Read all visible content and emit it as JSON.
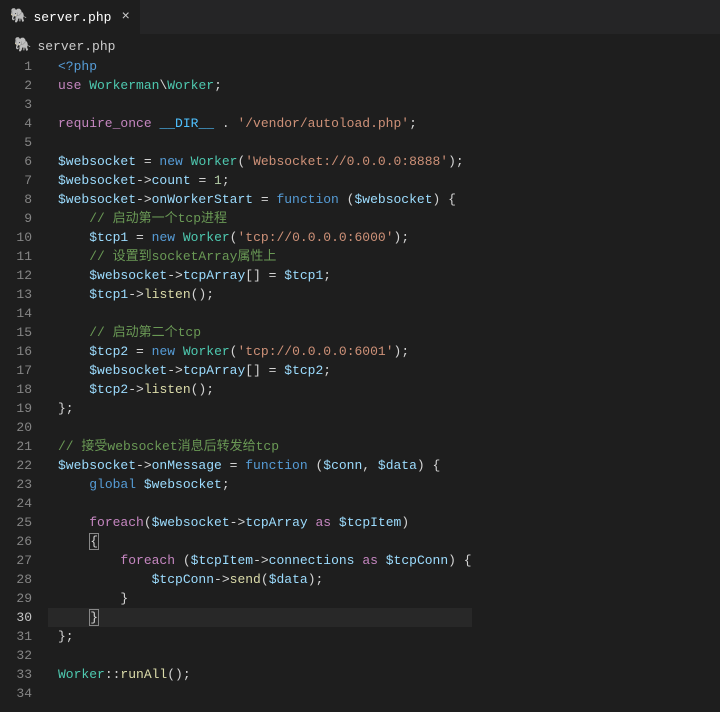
{
  "tab": {
    "filename": "server.php",
    "icon": "php-file-icon"
  },
  "breadcrumb": {
    "filename": "server.php"
  },
  "editor": {
    "activeLine": 30,
    "lines": [
      {
        "n": 1,
        "t": [
          {
            "c": "c-key",
            "s": "<?php"
          }
        ]
      },
      {
        "n": 2,
        "t": [
          {
            "c": "c-keyctl",
            "s": "use"
          },
          {
            "c": "c-pun",
            "s": " "
          },
          {
            "c": "c-type",
            "s": "Workerman"
          },
          {
            "c": "c-pun",
            "s": "\\"
          },
          {
            "c": "c-type",
            "s": "Worker"
          },
          {
            "c": "c-pun",
            "s": ";"
          }
        ]
      },
      {
        "n": 3,
        "t": []
      },
      {
        "n": 4,
        "t": [
          {
            "c": "c-keyctl",
            "s": "require_once"
          },
          {
            "c": "c-pun",
            "s": " "
          },
          {
            "c": "c-const",
            "s": "__DIR__"
          },
          {
            "c": "c-pun",
            "s": " . "
          },
          {
            "c": "c-str",
            "s": "'/vendor/autoload.php'"
          },
          {
            "c": "c-pun",
            "s": ";"
          }
        ]
      },
      {
        "n": 5,
        "t": []
      },
      {
        "n": 6,
        "t": [
          {
            "c": "c-var",
            "s": "$websocket"
          },
          {
            "c": "c-pun",
            "s": " = "
          },
          {
            "c": "c-key",
            "s": "new"
          },
          {
            "c": "c-pun",
            "s": " "
          },
          {
            "c": "c-type",
            "s": "Worker"
          },
          {
            "c": "c-pun",
            "s": "("
          },
          {
            "c": "c-str",
            "s": "'Websocket://0.0.0.0:8888'"
          },
          {
            "c": "c-pun",
            "s": ");"
          }
        ]
      },
      {
        "n": 7,
        "t": [
          {
            "c": "c-var",
            "s": "$websocket"
          },
          {
            "c": "c-pun",
            "s": "->"
          },
          {
            "c": "c-var",
            "s": "count"
          },
          {
            "c": "c-pun",
            "s": " = "
          },
          {
            "c": "c-num",
            "s": "1"
          },
          {
            "c": "c-pun",
            "s": ";"
          }
        ]
      },
      {
        "n": 8,
        "t": [
          {
            "c": "c-var",
            "s": "$websocket"
          },
          {
            "c": "c-pun",
            "s": "->"
          },
          {
            "c": "c-var",
            "s": "onWorkerStart"
          },
          {
            "c": "c-pun",
            "s": " = "
          },
          {
            "c": "c-key",
            "s": "function"
          },
          {
            "c": "c-pun",
            "s": " ("
          },
          {
            "c": "c-var",
            "s": "$websocket"
          },
          {
            "c": "c-pun",
            "s": ") {"
          }
        ]
      },
      {
        "n": 9,
        "t": [
          {
            "c": "c-pun",
            "s": "    "
          },
          {
            "c": "c-cmt",
            "s": "// 启动第一个tcp进程"
          }
        ]
      },
      {
        "n": 10,
        "t": [
          {
            "c": "c-pun",
            "s": "    "
          },
          {
            "c": "c-var",
            "s": "$tcp1"
          },
          {
            "c": "c-pun",
            "s": " = "
          },
          {
            "c": "c-key",
            "s": "new"
          },
          {
            "c": "c-pun",
            "s": " "
          },
          {
            "c": "c-type",
            "s": "Worker"
          },
          {
            "c": "c-pun",
            "s": "("
          },
          {
            "c": "c-str",
            "s": "'tcp://0.0.0.0:6000'"
          },
          {
            "c": "c-pun",
            "s": ");"
          }
        ]
      },
      {
        "n": 11,
        "t": [
          {
            "c": "c-pun",
            "s": "    "
          },
          {
            "c": "c-cmt",
            "s": "// 设置到socketArray属性上"
          }
        ]
      },
      {
        "n": 12,
        "t": [
          {
            "c": "c-pun",
            "s": "    "
          },
          {
            "c": "c-var",
            "s": "$websocket"
          },
          {
            "c": "c-pun",
            "s": "->"
          },
          {
            "c": "c-var",
            "s": "tcpArray"
          },
          {
            "c": "c-pun",
            "s": "[] = "
          },
          {
            "c": "c-var",
            "s": "$tcp1"
          },
          {
            "c": "c-pun",
            "s": ";"
          }
        ]
      },
      {
        "n": 13,
        "t": [
          {
            "c": "c-pun",
            "s": "    "
          },
          {
            "c": "c-var",
            "s": "$tcp1"
          },
          {
            "c": "c-pun",
            "s": "->"
          },
          {
            "c": "c-fn",
            "s": "listen"
          },
          {
            "c": "c-pun",
            "s": "();"
          }
        ]
      },
      {
        "n": 14,
        "t": []
      },
      {
        "n": 15,
        "t": [
          {
            "c": "c-pun",
            "s": "    "
          },
          {
            "c": "c-cmt",
            "s": "// 启动第二个tcp"
          }
        ]
      },
      {
        "n": 16,
        "t": [
          {
            "c": "c-pun",
            "s": "    "
          },
          {
            "c": "c-var",
            "s": "$tcp2"
          },
          {
            "c": "c-pun",
            "s": " = "
          },
          {
            "c": "c-key",
            "s": "new"
          },
          {
            "c": "c-pun",
            "s": " "
          },
          {
            "c": "c-type",
            "s": "Worker"
          },
          {
            "c": "c-pun",
            "s": "("
          },
          {
            "c": "c-str",
            "s": "'tcp://0.0.0.0:6001'"
          },
          {
            "c": "c-pun",
            "s": ");"
          }
        ]
      },
      {
        "n": 17,
        "t": [
          {
            "c": "c-pun",
            "s": "    "
          },
          {
            "c": "c-var",
            "s": "$websocket"
          },
          {
            "c": "c-pun",
            "s": "->"
          },
          {
            "c": "c-var",
            "s": "tcpArray"
          },
          {
            "c": "c-pun",
            "s": "[] = "
          },
          {
            "c": "c-var",
            "s": "$tcp2"
          },
          {
            "c": "c-pun",
            "s": ";"
          }
        ]
      },
      {
        "n": 18,
        "t": [
          {
            "c": "c-pun",
            "s": "    "
          },
          {
            "c": "c-var",
            "s": "$tcp2"
          },
          {
            "c": "c-pun",
            "s": "->"
          },
          {
            "c": "c-fn",
            "s": "listen"
          },
          {
            "c": "c-pun",
            "s": "();"
          }
        ]
      },
      {
        "n": 19,
        "t": [
          {
            "c": "c-pun",
            "s": "};"
          }
        ]
      },
      {
        "n": 20,
        "t": []
      },
      {
        "n": 21,
        "t": [
          {
            "c": "c-cmt",
            "s": "// 接受websocket消息后转发给tcp"
          }
        ]
      },
      {
        "n": 22,
        "t": [
          {
            "c": "c-var",
            "s": "$websocket"
          },
          {
            "c": "c-pun",
            "s": "->"
          },
          {
            "c": "c-var",
            "s": "onMessage"
          },
          {
            "c": "c-pun",
            "s": " = "
          },
          {
            "c": "c-key",
            "s": "function"
          },
          {
            "c": "c-pun",
            "s": " ("
          },
          {
            "c": "c-var",
            "s": "$conn"
          },
          {
            "c": "c-pun",
            "s": ", "
          },
          {
            "c": "c-var",
            "s": "$data"
          },
          {
            "c": "c-pun",
            "s": ") {"
          }
        ]
      },
      {
        "n": 23,
        "t": [
          {
            "c": "c-pun",
            "s": "    "
          },
          {
            "c": "c-key",
            "s": "global"
          },
          {
            "c": "c-pun",
            "s": " "
          },
          {
            "c": "c-var",
            "s": "$websocket"
          },
          {
            "c": "c-pun",
            "s": ";"
          }
        ]
      },
      {
        "n": 24,
        "t": []
      },
      {
        "n": 25,
        "t": [
          {
            "c": "c-pun",
            "s": "    "
          },
          {
            "c": "c-keyctl",
            "s": "foreach"
          },
          {
            "c": "c-pun",
            "s": "("
          },
          {
            "c": "c-var",
            "s": "$websocket"
          },
          {
            "c": "c-pun",
            "s": "->"
          },
          {
            "c": "c-var",
            "s": "tcpArray"
          },
          {
            "c": "c-pun",
            "s": " "
          },
          {
            "c": "c-keyctl",
            "s": "as"
          },
          {
            "c": "c-pun",
            "s": " "
          },
          {
            "c": "c-var",
            "s": "$tcpItem"
          },
          {
            "c": "c-pun",
            "s": ")"
          }
        ]
      },
      {
        "n": 26,
        "t": [
          {
            "c": "c-pun",
            "s": "    "
          },
          {
            "c": "c-pun bracket-box",
            "s": "{"
          }
        ]
      },
      {
        "n": 27,
        "t": [
          {
            "c": "c-pun",
            "s": "        "
          },
          {
            "c": "c-keyctl",
            "s": "foreach"
          },
          {
            "c": "c-pun",
            "s": " ("
          },
          {
            "c": "c-var",
            "s": "$tcpItem"
          },
          {
            "c": "c-pun",
            "s": "->"
          },
          {
            "c": "c-var",
            "s": "connections"
          },
          {
            "c": "c-pun",
            "s": " "
          },
          {
            "c": "c-keyctl",
            "s": "as"
          },
          {
            "c": "c-pun",
            "s": " "
          },
          {
            "c": "c-var",
            "s": "$tcpConn"
          },
          {
            "c": "c-pun",
            "s": ") {"
          }
        ]
      },
      {
        "n": 28,
        "t": [
          {
            "c": "c-pun",
            "s": "            "
          },
          {
            "c": "c-var",
            "s": "$tcpConn"
          },
          {
            "c": "c-pun",
            "s": "->"
          },
          {
            "c": "c-fn",
            "s": "send"
          },
          {
            "c": "c-pun",
            "s": "("
          },
          {
            "c": "c-var",
            "s": "$data"
          },
          {
            "c": "c-pun",
            "s": ");"
          }
        ]
      },
      {
        "n": 29,
        "t": [
          {
            "c": "c-pun",
            "s": "        }"
          }
        ]
      },
      {
        "n": 30,
        "t": [
          {
            "c": "c-pun",
            "s": "    "
          },
          {
            "c": "c-pun bracket-box",
            "s": "}"
          }
        ]
      },
      {
        "n": 31,
        "t": [
          {
            "c": "c-pun",
            "s": "};"
          }
        ]
      },
      {
        "n": 32,
        "t": []
      },
      {
        "n": 33,
        "t": [
          {
            "c": "c-type",
            "s": "Worker"
          },
          {
            "c": "c-pun",
            "s": "::"
          },
          {
            "c": "c-fn",
            "s": "runAll"
          },
          {
            "c": "c-pun",
            "s": "();"
          }
        ]
      },
      {
        "n": 34,
        "t": []
      }
    ]
  }
}
